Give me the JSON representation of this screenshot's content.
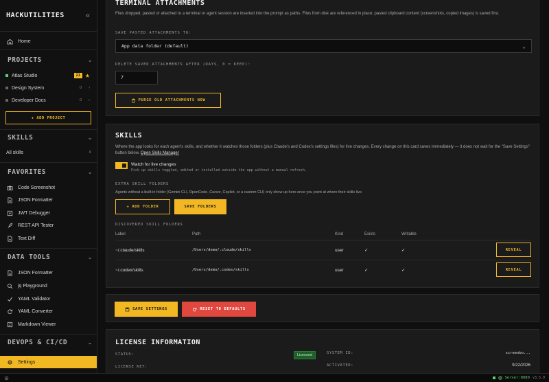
{
  "sidebar": {
    "brand": "HACKUTILITIES",
    "home": "Home",
    "projects_title": "PROJECTS",
    "projects": [
      {
        "name": "Atlas Studio",
        "badge": "21",
        "active": true
      },
      {
        "name": "Design System",
        "count": "0"
      },
      {
        "name": "Developer Docs",
        "count": "0"
      }
    ],
    "add_project": "+ ADD PROJECT",
    "skills_title": "SKILLS",
    "all_skills": "All skills",
    "all_skills_count": "6",
    "favorites_title": "FAVORITES",
    "favorites": [
      "Code Screenshot",
      "JSON Formatter",
      "JWT Debugger",
      "REST API Tester",
      "Text Diff"
    ],
    "data_tools_title": "DATA TOOLS",
    "data_tools": [
      "JSON Formatter",
      "jq Playground",
      "YAML Validator",
      "YAML Converter",
      "Markdown Viewer"
    ],
    "devops_title": "DEVOPS & CI/CD",
    "settings": "Settings"
  },
  "terminal": {
    "title": "TERMINAL ATTACHMENTS",
    "desc": "Files dropped, pasted or attached to a terminal or agent session are inserted into the prompt as paths. Files from disk are referenced in place; pasted clipboard content (screenshots, copied images) is saved first.",
    "save_label": "SAVE PASTED ATTACHMENTS TO:",
    "save_value": "App data folder (default)",
    "delete_label": "DELETE SAVED ATTACHMENTS AFTER (DAYS, 0 = KEEP):",
    "delete_value": "7",
    "purge": "PURGE OLD ATTACHMENTS NOW"
  },
  "skills": {
    "title": "SKILLS",
    "desc": "Where the app looks for each agent's skills, and whether it watches those folders (plus Claude's and Codex's settings files) for live changes. Every change on this card saves immediately — it does not wait for the \"Save Settings\" button below.",
    "manager_link": "Open Skills Manager",
    "watch_title": "Watch for live changes",
    "watch_sub": "Pick up skills toggled, edited or installed outside the app without a manual refresh.",
    "extra_label": "EXTRA SKILL FOLDERS",
    "extra_desc": "Agents without a built-in folder (Gemini CLI, OpenCode, Cursor, Copilot, or a custom CLI) only show up here once you point at where their skills live.",
    "add_folder": "+ ADD FOLDER",
    "save_folders": "SAVE FOLDERS",
    "discovered_label": "DISCOVERED SKILL FOLDERS",
    "columns": [
      "Label",
      "Path",
      "Kind",
      "Exists",
      "Writable"
    ],
    "rows": [
      {
        "label": "~/.claude/skills",
        "path": "/Users/demo/.claude/skills",
        "kind": "user",
        "exists": "✓",
        "writable": "✓",
        "action": "REVEAL"
      },
      {
        "label": "~/.codex/skills",
        "path": "/Users/demo/.codex/skills",
        "kind": "user",
        "exists": "✓",
        "writable": "✓",
        "action": "REVEAL"
      }
    ]
  },
  "actions": {
    "save_settings": "SAVE SETTINGS",
    "reset_defaults": "RESET TO DEFAULTS"
  },
  "license": {
    "title": "LICENSE INFORMATION",
    "status_label": "STATUS:",
    "status_value": "Licensed",
    "key_label": "LICENSE KEY:",
    "system_id_label": "SYSTEM ID:",
    "system_id_value": "screenbo...",
    "activated_label": "ACTIVATED:",
    "activated_value": "9/22/2026"
  },
  "status_bar": {
    "server": "Server:8080",
    "version": "v3.5.0"
  },
  "colors": {
    "accent": "#f2b824",
    "danger": "#e0473e",
    "success": "#5fcf6b"
  }
}
